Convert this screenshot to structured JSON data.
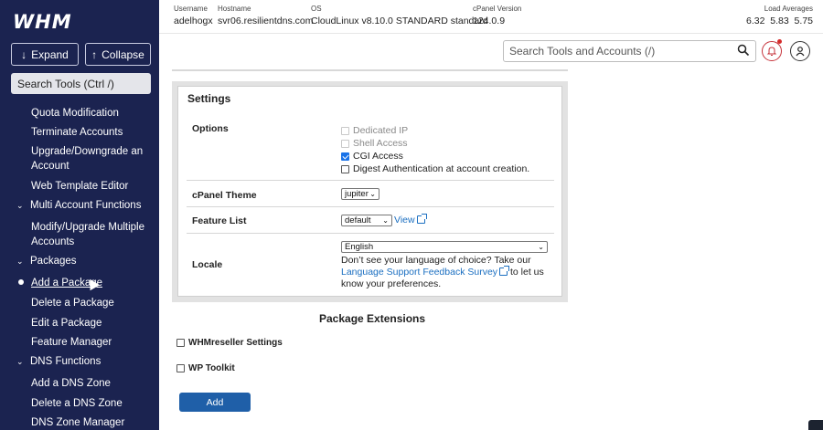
{
  "logo": "WHM",
  "sidebar": {
    "expand_label": "Expand",
    "collapse_label": "Collapse",
    "search_placeholder": "Search Tools (Ctrl /)",
    "items": [
      {
        "label": "Quota Modification",
        "type": "item"
      },
      {
        "label": "Terminate Accounts",
        "type": "item"
      },
      {
        "label": "Upgrade/Downgrade an Account",
        "type": "item"
      },
      {
        "label": "Web Template Editor",
        "type": "item"
      },
      {
        "label": "Multi Account Functions",
        "type": "group"
      },
      {
        "label": "Modify/Upgrade Multiple Accounts",
        "type": "item"
      },
      {
        "label": "Packages",
        "type": "group"
      },
      {
        "label": "Add a Package",
        "type": "item",
        "active": true
      },
      {
        "label": "Delete a Package",
        "type": "item"
      },
      {
        "label": "Edit a Package",
        "type": "item"
      },
      {
        "label": "Feature Manager",
        "type": "item"
      },
      {
        "label": "DNS Functions",
        "type": "group"
      },
      {
        "label": "Add a DNS Zone",
        "type": "item"
      },
      {
        "label": "Delete a DNS Zone",
        "type": "item"
      },
      {
        "label": "DNS Zone Manager",
        "type": "item"
      }
    ]
  },
  "topinfo": {
    "username_label": "Username",
    "username": "adelhogx",
    "hostname_label": "Hostname",
    "hostname": "svr06.resilientdns.com",
    "os_label": "OS",
    "os": "CloudLinux v8.10.0 STANDARD standard",
    "cpanel_label": "cPanel Version",
    "cpanel": "124.0.9",
    "load_label": "Load Averages",
    "load": "6.32  5.83  5.75"
  },
  "search": {
    "placeholder": "Search Tools and Accounts (/)"
  },
  "settings": {
    "title": "Settings",
    "options_label": "Options",
    "options": [
      {
        "label": "Dedicated IP",
        "checked": false,
        "disabled": true
      },
      {
        "label": "Shell Access",
        "checked": false,
        "disabled": true
      },
      {
        "label": "CGI Access",
        "checked": true,
        "disabled": false
      },
      {
        "label": "Digest Authentication at account creation.",
        "checked": false,
        "disabled": false
      }
    ],
    "theme_label": "cPanel Theme",
    "theme_value": "jupiter",
    "feature_label": "Feature List",
    "feature_value": "default",
    "view_label": "View",
    "locale_label": "Locale",
    "locale_value": "English",
    "locale_text_1": "Don’t see your language of choice? Take our",
    "locale_link": "Language Support Feedback Survey",
    "locale_text_2": "to let us know your preferences."
  },
  "extensions": {
    "title": "Package Extensions",
    "items": [
      "WHMreseller Settings",
      "WP Toolkit"
    ]
  },
  "add_button": "Add",
  "colors": {
    "sidebar": "#1b2350",
    "accent": "#1f5fa8",
    "link": "#1b6fc1"
  }
}
